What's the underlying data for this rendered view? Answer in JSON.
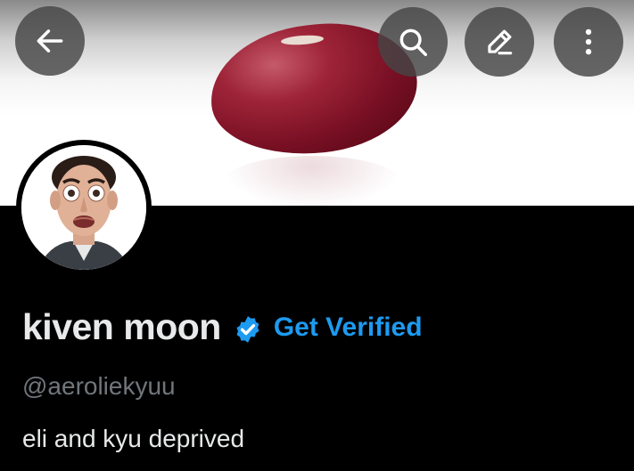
{
  "header": {
    "back_icon": "arrow-left-icon",
    "search_icon": "search-icon",
    "edit_icon": "pencil-icon",
    "more_icon": "more-vertical-icon"
  },
  "banner": {
    "image": "red kidney bean on white background"
  },
  "avatar": {
    "image": "profile photo of a man with wide eyes"
  },
  "profile": {
    "display_name": "kiven moon",
    "verified_badge_icon": "verified-badge-icon",
    "get_verified_label": "Get Verified",
    "handle": "@aeroliekyuu",
    "bio": "eli and kyu deprived"
  },
  "colors": {
    "background": "#000000",
    "accent": "#1d9bf0",
    "primary_text": "#e7e9ea",
    "secondary_text": "#71767b"
  }
}
